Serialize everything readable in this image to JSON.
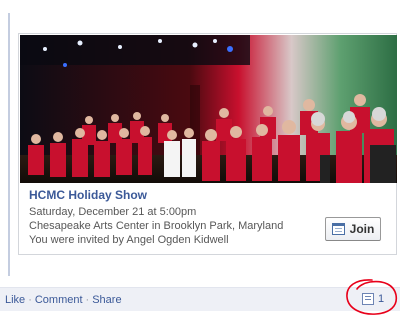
{
  "event": {
    "title": "HCMC Holiday Show",
    "date": "Saturday, December 21 at 5:00pm",
    "location": "Chesapeake Arts Center in Brooklyn Park, Maryland",
    "invited_by": "You were invited by Angel Ogden Kidwell",
    "join_label": "Join",
    "join_icon": "calendar-icon"
  },
  "footer": {
    "like_label": "Like",
    "comment_label": "Comment",
    "share_label": "Share",
    "separator": "·",
    "comment_count": "1",
    "comment_icon": "comment-icon"
  },
  "colors": {
    "link": "#3b5998",
    "footer_bg": "#eef0f6",
    "annotation": "#e8001a",
    "choir_red": "#c8102e"
  }
}
